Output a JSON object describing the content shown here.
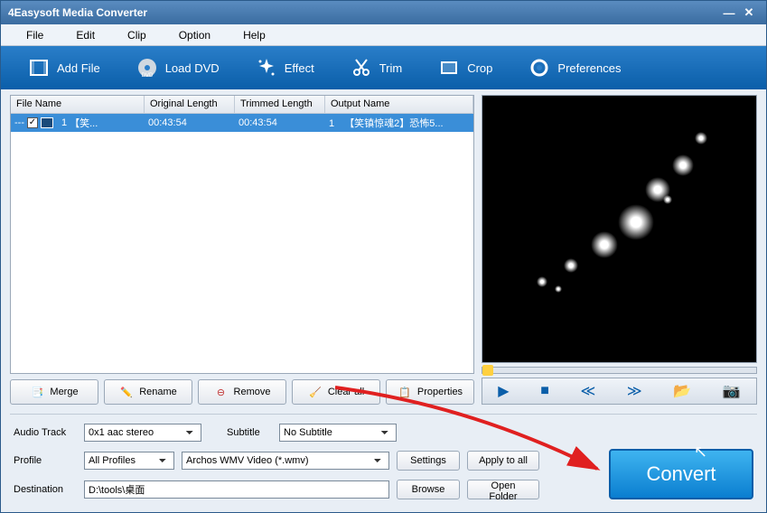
{
  "window": {
    "title": "4Easysoft Media Converter"
  },
  "menu": {
    "file": "File",
    "edit": "Edit",
    "clip": "Clip",
    "option": "Option",
    "help": "Help"
  },
  "toolbar": {
    "addfile": "Add File",
    "loaddvd": "Load DVD",
    "effect": "Effect",
    "trim": "Trim",
    "crop": "Crop",
    "preferences": "Preferences"
  },
  "table": {
    "headers": {
      "filename": "File Name",
      "origlen": "Original Length",
      "trimlen": "Trimmed Length",
      "outname": "Output Name"
    },
    "row": {
      "idx": "1",
      "name": "【笑...",
      "origlen": "00:43:54",
      "trimlen": "00:43:54",
      "outidx": "1",
      "outname": "【笑镇惊魂2】恐怖5..."
    }
  },
  "actions": {
    "merge": "Merge",
    "rename": "Rename",
    "remove": "Remove",
    "clearall": "Clear all",
    "properties": "Properties"
  },
  "settings": {
    "audiotrack_label": "Audio Track",
    "audiotrack_value": "0x1 aac stereo",
    "subtitle_label": "Subtitle",
    "subtitle_value": "No Subtitle",
    "profile_label": "Profile",
    "profile_cat": "All Profiles",
    "profile_value": "Archos WMV Video (*.wmv)",
    "destination_label": "Destination",
    "destination_value": "D:\\tools\\桌面",
    "settings_btn": "Settings",
    "applyall_btn": "Apply to all",
    "browse_btn": "Browse",
    "openfolder_btn": "Open Folder"
  },
  "convert": {
    "label": "Convert"
  }
}
